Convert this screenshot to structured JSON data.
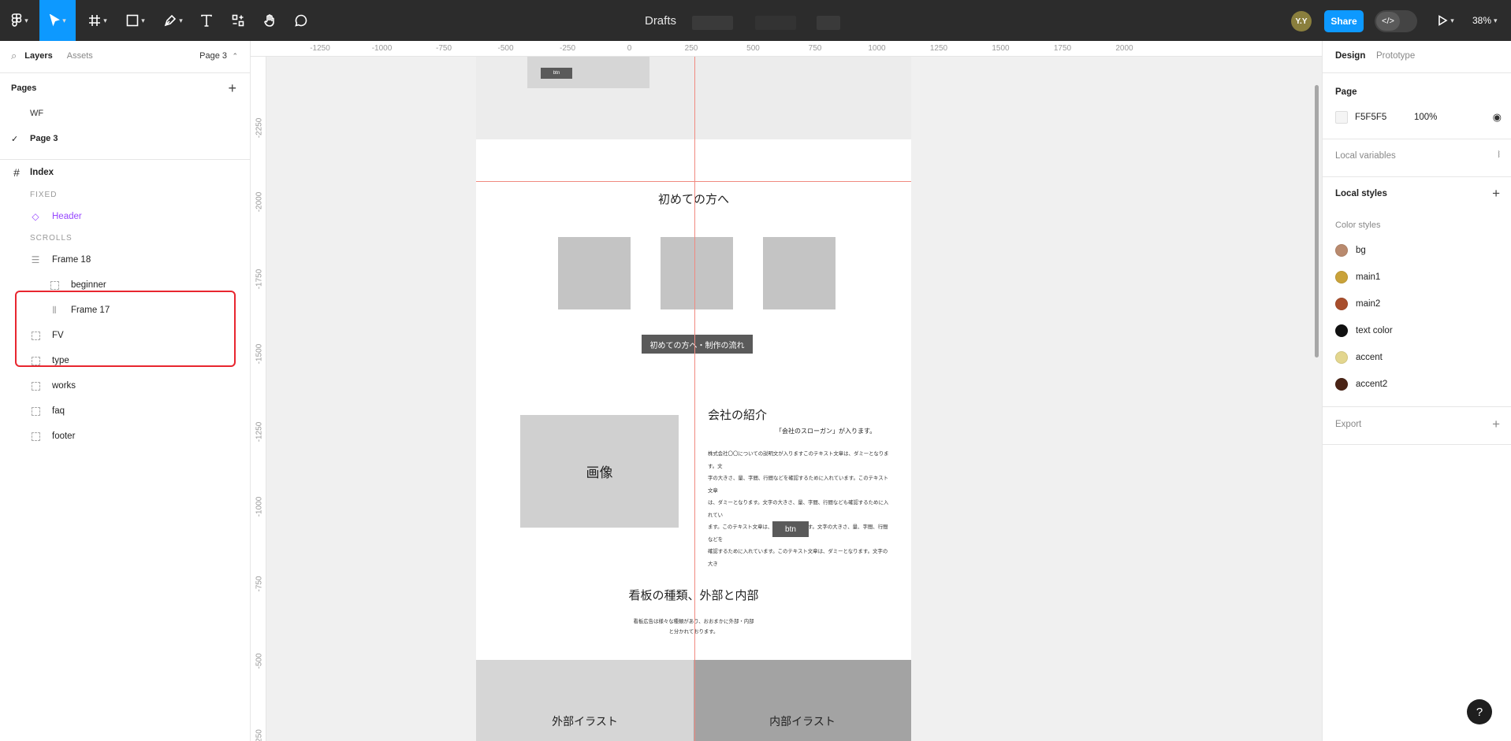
{
  "toolbar": {
    "file_title": "Drafts",
    "avatar_initials": "Y.Y",
    "share_label": "Share",
    "dev_mode_icon": "</>",
    "zoom": "38%"
  },
  "left_panel": {
    "tabs": {
      "layers": "Layers",
      "assets": "Assets"
    },
    "page_selector": "Page 3",
    "pages_title": "Pages",
    "pages": [
      {
        "label": "WF",
        "checked": false
      },
      {
        "label": "Page 3",
        "checked": true
      }
    ],
    "layers": {
      "root": "Index",
      "fixed_label": "FIXED",
      "header": "Header",
      "scrolls_label": "SCROLLS",
      "items": [
        {
          "label": "Frame 18",
          "icon": "vertical-stack-icon"
        },
        {
          "label": "beginner",
          "icon": "frame-dashed-icon"
        },
        {
          "label": "Frame 17",
          "icon": "horizontal-stack-icon"
        },
        {
          "label": "FV",
          "icon": "frame-dashed-icon"
        },
        {
          "label": "type",
          "icon": "frame-dashed-icon"
        },
        {
          "label": "works",
          "icon": "frame-dashed-icon"
        },
        {
          "label": "faq",
          "icon": "frame-dashed-icon"
        },
        {
          "label": "footer",
          "icon": "frame-dashed-icon"
        }
      ]
    }
  },
  "canvas": {
    "ruler_top": [
      "-1250",
      "-1000",
      "-750",
      "-500",
      "-250",
      "0",
      "250",
      "500",
      "750",
      "1000",
      "1250",
      "1500",
      "1750",
      "2000"
    ],
    "ruler_left": [
      "-2250",
      "-2000",
      "-1750",
      "-1500",
      "-1250",
      "-1000",
      "-750",
      "-500",
      "250"
    ],
    "frame": {
      "top_small_btn": "btn",
      "beginner_heading": "初めての方へ",
      "beginner_button": "初めての方へ・制作の流れ",
      "image_placeholder": "画像",
      "company_heading": "会社の紹介",
      "slogan": "「会社のスローガン」が入ります。",
      "company_text": [
        "株式会社〇〇についての説明文が入りますこのテキスト文章は、ダミーとなります。文",
        "字の大きさ、量、字間、行間などを確認するために入れています。このテキスト文章",
        "は、ダミーとなります。文字の大きさ、量、字間、行間なども確認するために入れてい",
        "ます。このテキスト文章は、ダミーとなります。文字の大きさ、量、字間、行間などを",
        "確認するために入れています。このテキスト文章は、ダミーとなります。文字の大き"
      ],
      "company_btn": "btn",
      "sign_heading": "看板の種類、外部と内部",
      "sign_text": [
        "看板広告は様々な種類があり、おおまかに外部・内部",
        "と分かれております。"
      ],
      "exterior_label": "外部イラスト",
      "interior_label": "内部イラスト"
    }
  },
  "right_panel": {
    "tabs": {
      "design": "Design",
      "prototype": "Prototype"
    },
    "page_section": "Page",
    "page_color_hex": "F5F5F5",
    "page_color": "#F5F5F5",
    "page_opacity": "100%",
    "local_variables": "Local variables",
    "local_styles": "Local styles",
    "color_styles_label": "Color styles",
    "color_styles": [
      {
        "name": "bg",
        "color": "#B98A6E"
      },
      {
        "name": "main1",
        "color": "#C9A23A"
      },
      {
        "name": "main2",
        "color": "#A84E2C"
      },
      {
        "name": "text color",
        "color": "#111111"
      },
      {
        "name": "accent",
        "color": "#E3D68E"
      },
      {
        "name": "accent2",
        "color": "#4A2416"
      }
    ],
    "export_label": "Export"
  },
  "help": "?"
}
